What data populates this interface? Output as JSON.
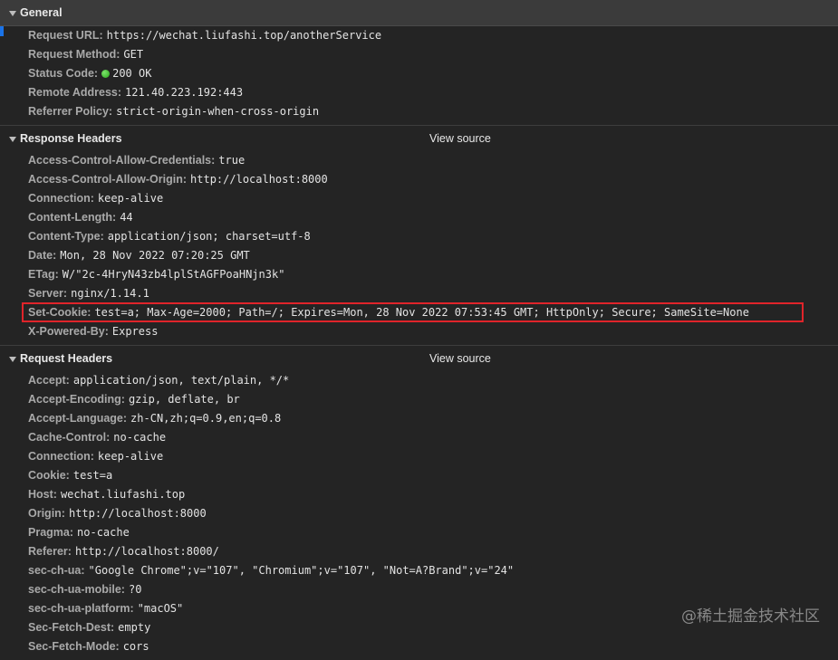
{
  "general": {
    "title": "General",
    "rows": [
      {
        "key": "Request URL:",
        "value": "https://wechat.liufashi.top/anotherService"
      },
      {
        "key": "Request Method:",
        "value": "GET"
      },
      {
        "key": "Status Code:",
        "value": "200 OK"
      },
      {
        "key": "Remote Address:",
        "value": "121.40.223.192:443"
      },
      {
        "key": "Referrer Policy:",
        "value": "strict-origin-when-cross-origin"
      }
    ]
  },
  "response_headers": {
    "title": "Response Headers",
    "view_source": "View source",
    "rows": [
      {
        "key": "Access-Control-Allow-Credentials:",
        "value": "true"
      },
      {
        "key": "Access-Control-Allow-Origin:",
        "value": "http://localhost:8000"
      },
      {
        "key": "Connection:",
        "value": "keep-alive"
      },
      {
        "key": "Content-Length:",
        "value": "44"
      },
      {
        "key": "Content-Type:",
        "value": "application/json; charset=utf-8"
      },
      {
        "key": "Date:",
        "value": "Mon, 28 Nov 2022 07:20:25 GMT"
      },
      {
        "key": "ETag:",
        "value": "W/\"2c-4HryN43zb4lplStAGFPoaHNjn3k\""
      },
      {
        "key": "Server:",
        "value": "nginx/1.14.1"
      },
      {
        "key": "Set-Cookie:",
        "value": "test=a; Max-Age=2000; Path=/; Expires=Mon, 28 Nov 2022 07:53:45 GMT; HttpOnly; Secure; SameSite=None"
      },
      {
        "key": "X-Powered-By:",
        "value": "Express"
      }
    ]
  },
  "request_headers": {
    "title": "Request Headers",
    "view_source": "View source",
    "rows": [
      {
        "key": "Accept:",
        "value": "application/json, text/plain, */*"
      },
      {
        "key": "Accept-Encoding:",
        "value": "gzip, deflate, br"
      },
      {
        "key": "Accept-Language:",
        "value": "zh-CN,zh;q=0.9,en;q=0.8"
      },
      {
        "key": "Cache-Control:",
        "value": "no-cache"
      },
      {
        "key": "Connection:",
        "value": "keep-alive"
      },
      {
        "key": "Cookie:",
        "value": "test=a"
      },
      {
        "key": "Host:",
        "value": "wechat.liufashi.top"
      },
      {
        "key": "Origin:",
        "value": "http://localhost:8000"
      },
      {
        "key": "Pragma:",
        "value": "no-cache"
      },
      {
        "key": "Referer:",
        "value": "http://localhost:8000/"
      },
      {
        "key": "sec-ch-ua:",
        "value": "\"Google Chrome\";v=\"107\", \"Chromium\";v=\"107\", \"Not=A?Brand\";v=\"24\""
      },
      {
        "key": "sec-ch-ua-mobile:",
        "value": "?0"
      },
      {
        "key": "sec-ch-ua-platform:",
        "value": "\"macOS\""
      },
      {
        "key": "Sec-Fetch-Dest:",
        "value": "empty"
      },
      {
        "key": "Sec-Fetch-Mode:",
        "value": "cors"
      }
    ]
  },
  "watermark": "@稀土掘金技术社区",
  "colors": {
    "background": "#242424",
    "highlight": "#e0242a",
    "status_ok": "#34c02a"
  }
}
